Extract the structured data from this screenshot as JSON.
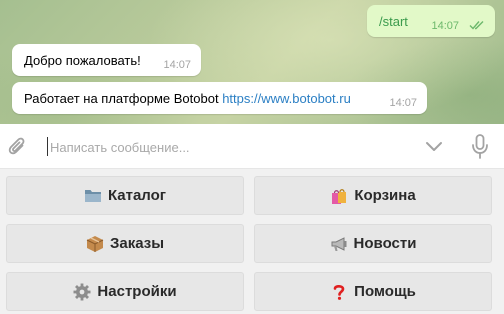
{
  "chat": {
    "messages": [
      {
        "direction": "out",
        "text": "/start",
        "time": "14:07",
        "read": true
      },
      {
        "direction": "in",
        "text": "Добро пожаловать!",
        "time": "14:07"
      },
      {
        "direction": "in",
        "text": "Работает на платформе Botobot",
        "link": "https://www.botobot.ru",
        "time": "14:07"
      }
    ]
  },
  "composer": {
    "placeholder": "Написать сообщение..."
  },
  "keyboard": {
    "buttons": [
      {
        "icon": "folder-icon",
        "label": "Каталог"
      },
      {
        "icon": "shopping-bags-icon",
        "label": "Корзина"
      },
      {
        "icon": "package-icon",
        "label": "Заказы"
      },
      {
        "icon": "megaphone-icon",
        "label": "Новости"
      },
      {
        "icon": "gear-icon",
        "label": "Настройки"
      },
      {
        "icon": "question-mark-icon",
        "label": "Помощь"
      }
    ]
  },
  "colors": {
    "outgoing_bubble": "#e2f9c8",
    "outgoing_text": "#3b9b4d",
    "link": "#2b7fc4",
    "keyboard_button": "#e7e7e7"
  }
}
